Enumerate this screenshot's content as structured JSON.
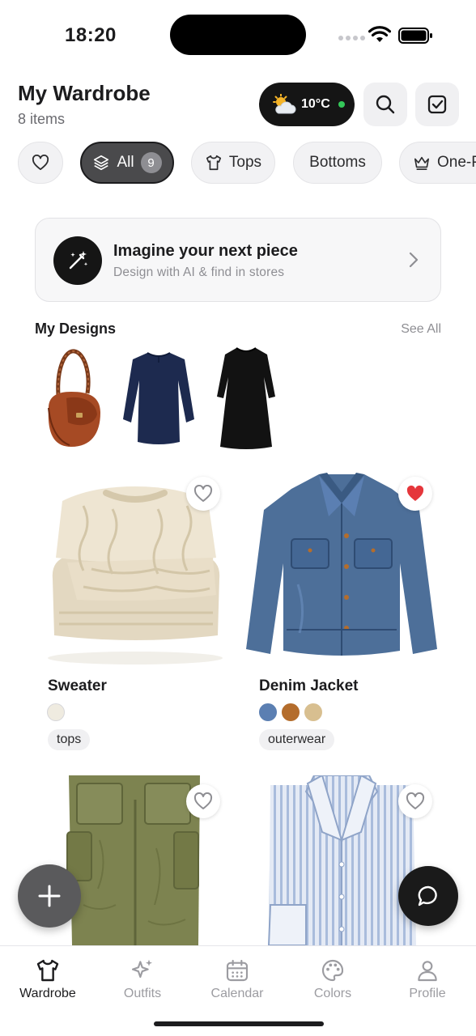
{
  "status": {
    "time": "18:20"
  },
  "header": {
    "title": "My Wardrobe",
    "subtitle": "8 items",
    "weather": {
      "temp": "10°C",
      "icon": "partly-sunny-icon"
    }
  },
  "filters": {
    "chips": [
      {
        "label": "",
        "icon": "heart-icon"
      },
      {
        "label": "All",
        "count": "9",
        "icon": "layers-icon",
        "active": true
      },
      {
        "label": "Tops",
        "icon": "tshirt-icon"
      },
      {
        "label": "Bottoms"
      },
      {
        "label": "One-P",
        "icon": "crown-icon"
      }
    ]
  },
  "banner": {
    "title": "Imagine your next piece",
    "subtitle": "Design with AI & find in stores"
  },
  "designs": {
    "title": "My Designs",
    "see_all": "See All",
    "items": [
      "bag-image",
      "navy-top-image",
      "black-dress-image"
    ]
  },
  "items": [
    {
      "name": "Sweater",
      "tag": "tops",
      "colors": [
        "#efebe0"
      ],
      "favorite": false
    },
    {
      "name": "Denim Jacket",
      "tag": "outerwear",
      "colors": [
        "#5b7fb2",
        "#b46d2c",
        "#d8bf90"
      ],
      "favorite": true
    },
    {
      "name": "",
      "tag": "",
      "colors": [],
      "favorite": false
    },
    {
      "name": "",
      "tag": "",
      "colors": [],
      "favorite": false
    }
  ],
  "tabs": [
    {
      "label": "Wardrobe",
      "icon": "tshirt-icon",
      "active": true
    },
    {
      "label": "Outfits",
      "icon": "sparkles-icon"
    },
    {
      "label": "Calendar",
      "icon": "calendar-icon"
    },
    {
      "label": "Colors",
      "icon": "palette-icon"
    },
    {
      "label": "Profile",
      "icon": "person-icon"
    }
  ],
  "colors": {
    "accent_dark": "#151515",
    "heart_red": "#e5363b",
    "online_green": "#34c759"
  }
}
